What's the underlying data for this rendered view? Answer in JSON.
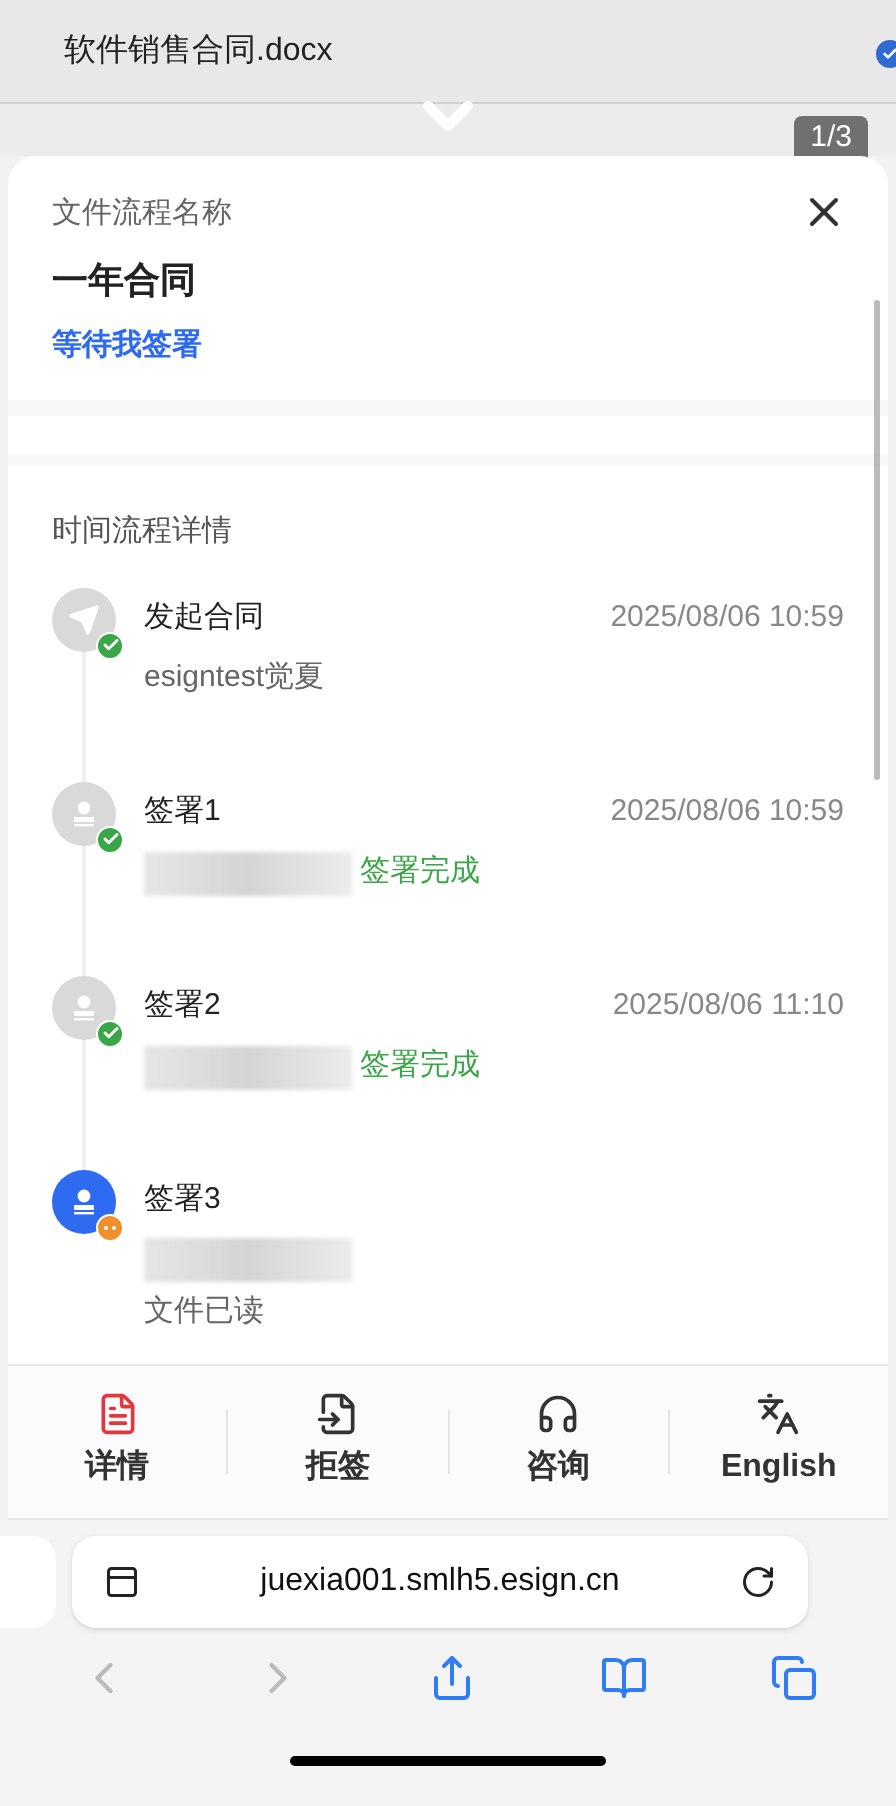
{
  "document": {
    "file_name": "软件销售合同.docx",
    "page_indicator": "1/3"
  },
  "flow": {
    "label": "文件流程名称",
    "name": "一年合同",
    "status": "等待我签署"
  },
  "timeline": {
    "title": "时间流程详情",
    "steps": [
      {
        "kind": "send",
        "title": "发起合同",
        "time": "2025/08/06 10:59",
        "completed": true,
        "active": false,
        "detail": {
          "redacted": false,
          "text": "esigntest觉夏",
          "highlighted": false
        }
      },
      {
        "kind": "sign",
        "title": "签署1",
        "time": "2025/08/06 10:59",
        "completed": true,
        "active": false,
        "detail": {
          "redacted": true,
          "text": "签署完成",
          "highlighted": true
        }
      },
      {
        "kind": "sign",
        "title": "签署2",
        "time": "2025/08/06 11:10",
        "completed": true,
        "active": false,
        "detail": {
          "redacted": true,
          "text": "签署完成",
          "highlighted": true
        }
      },
      {
        "kind": "sign",
        "title": "签署3",
        "completed": false,
        "active": true,
        "detail": {
          "redacted": true,
          "text": "文件已读",
          "highlighted": false
        }
      }
    ]
  },
  "toolbar": [
    {
      "kind": "details",
      "label": "详情"
    },
    {
      "kind": "reject",
      "label": "拒签"
    },
    {
      "kind": "support",
      "label": "咨询"
    },
    {
      "kind": "language",
      "label": "English"
    }
  ],
  "browser": {
    "url": "juexia001.smlh5.esign.cn"
  }
}
